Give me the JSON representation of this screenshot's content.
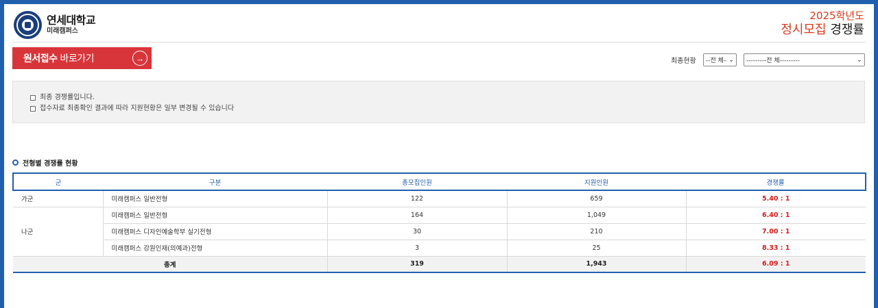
{
  "header": {
    "university_name": "연세대학교",
    "campus_name": "미래캠퍼스",
    "year": "2025학년도",
    "title_prefix": "정시모집",
    "title_suffix": "경쟁률"
  },
  "apply_button": {
    "strong": "원서접수",
    "rest": "바로가기"
  },
  "filter": {
    "label": "최종현황",
    "select1_value": "--전 체--",
    "select2_value": "---------전 체---------"
  },
  "notice": {
    "lines": [
      "최종 경쟁률입니다.",
      "접수자료 최종확인 결과에 따라 지원현황은 일부 변경될 수 있습니다"
    ]
  },
  "section": {
    "title": "전형별 경쟁률 현황"
  },
  "table": {
    "headers": {
      "group": "군",
      "category": "구분",
      "quota": "총모집인원",
      "applicants": "지원인원",
      "ratio": "경쟁률"
    },
    "rows": [
      {
        "group": "가군",
        "category": "미래캠퍼스 일반전형",
        "quota": "122",
        "applicants": "659",
        "ratio": "5.40 : 1"
      },
      {
        "group": "나군",
        "category": "미래캠퍼스 일반전형",
        "quota": "164",
        "applicants": "1,049",
        "ratio": "6.40 : 1"
      },
      {
        "group": "",
        "category": "미래캠퍼스 디자인예술학부 실기전형",
        "quota": "30",
        "applicants": "210",
        "ratio": "7.00 : 1"
      },
      {
        "group": "",
        "category": "미래캠퍼스 강원인재(의예과)전형",
        "quota": "3",
        "applicants": "25",
        "ratio": "8.33 : 1"
      }
    ],
    "total": {
      "label": "총계",
      "quota": "319",
      "applicants": "1,943",
      "ratio": "6.09 : 1"
    }
  },
  "colors": {
    "frame": "#1f5fae",
    "accent_red": "#d8353a",
    "ratio_red": "#d81b1b"
  },
  "icons": {
    "logo": "university-seal-icon",
    "apply_arrow": "arrow-right-circle-icon",
    "select_chevron": "chevron-down-icon",
    "checkbox": "checkbox-icon",
    "bullet": "bullet-icon"
  }
}
